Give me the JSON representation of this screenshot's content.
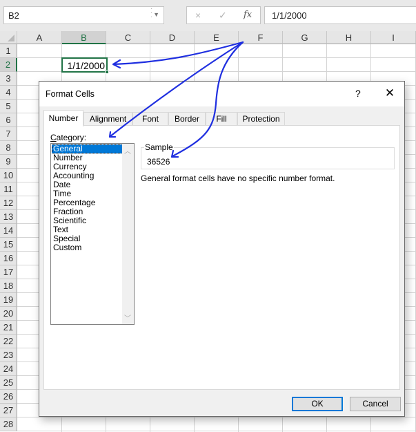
{
  "formula_bar": {
    "name_box": "B2",
    "cancel_icon": "×",
    "enter_icon": "✓",
    "fx_icon": "fx",
    "formula": "1/1/2000"
  },
  "sheet": {
    "columns": [
      "A",
      "B",
      "C",
      "D",
      "E",
      "F",
      "G",
      "H",
      "I"
    ],
    "selected_column": "B",
    "rows": [
      "1",
      "2",
      "3",
      "4",
      "5",
      "6",
      "7",
      "8",
      "9",
      "10",
      "11",
      "12",
      "13",
      "14",
      "15",
      "16",
      "17",
      "18",
      "19",
      "20",
      "21",
      "22",
      "23",
      "24",
      "25",
      "26",
      "27",
      "28"
    ],
    "selected_row": "2",
    "active_cell": {
      "ref": "B2",
      "value": "1/1/2000"
    }
  },
  "dialog": {
    "title": "Format Cells",
    "help_label": "?",
    "close_label": "✕",
    "tabs": [
      {
        "label": "Number",
        "active": true
      },
      {
        "label": "Alignment",
        "active": false
      },
      {
        "label": "Font",
        "active": false
      },
      {
        "label": "Border",
        "active": false
      },
      {
        "label": "Fill",
        "active": false
      },
      {
        "label": "Protection",
        "active": false
      }
    ],
    "category_label_accel": "C",
    "category_label_rest": "ategory:",
    "categories": [
      "General",
      "Number",
      "Currency",
      "Accounting",
      "Date",
      "Time",
      "Percentage",
      "Fraction",
      "Scientific",
      "Text",
      "Special",
      "Custom"
    ],
    "selected_category": "General",
    "sample_label": "Sample",
    "sample_value": "36526",
    "description": "General format cells have no specific number format.",
    "ok_label": "OK",
    "cancel_label": "Cancel"
  },
  "annotation": {
    "arrow_color": "#1f2fe0",
    "targets": [
      "active-cell-b2",
      "category-listbox",
      "sample-value"
    ]
  },
  "colors": {
    "excel_green": "#217346",
    "selection_blue": "#0078d7"
  }
}
